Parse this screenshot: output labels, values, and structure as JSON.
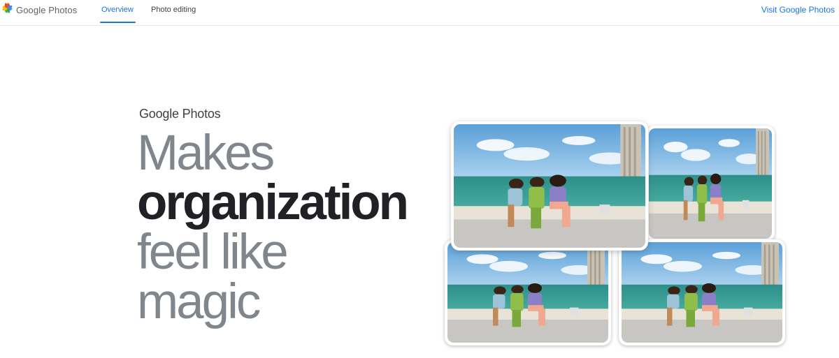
{
  "header": {
    "brand_name": "Google Photos",
    "tabs": [
      {
        "label": "Overview",
        "active": true
      },
      {
        "label": "Photo editing",
        "active": false
      }
    ],
    "visit_link": "Visit Google Photos"
  },
  "hero": {
    "brand_name": "Google Photos",
    "headline_lines": [
      "Makes",
      "organization",
      "feel like",
      "magic"
    ]
  },
  "photos": [
    {
      "name": "photo-main",
      "selected": true
    },
    {
      "name": "photo-top-right",
      "selected": false
    },
    {
      "name": "photo-bottom-left",
      "selected": false
    },
    {
      "name": "photo-bottom-right",
      "selected": false
    }
  ],
  "colors": {
    "accent": "#1a73e8",
    "headline_muted": "#80868b",
    "headline_dark": "#202124"
  }
}
